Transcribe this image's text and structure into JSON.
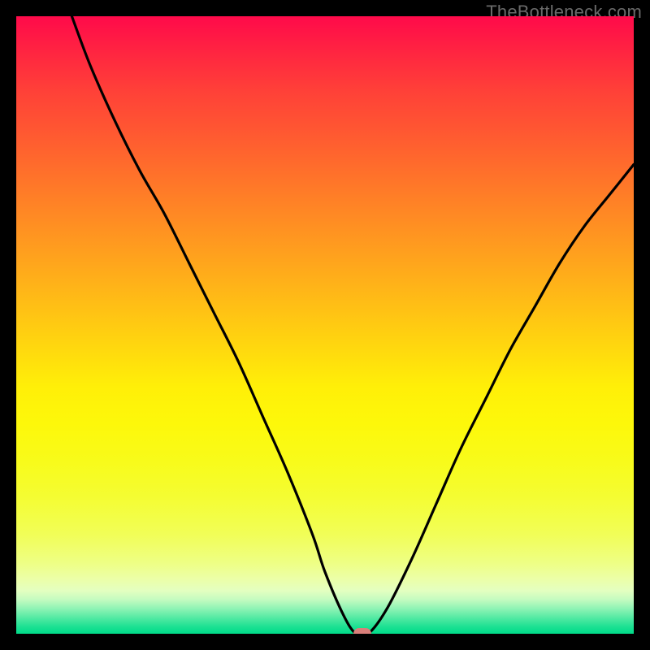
{
  "attribution": "TheBottleneck.com",
  "colors": {
    "background": "#000000",
    "curve": "#000000",
    "marker": "#d97f7a",
    "gradient_top": "#ff0a4a",
    "gradient_mid": "#ffef08",
    "gradient_bottom": "#00db89"
  },
  "chart_data": {
    "type": "line",
    "title": "",
    "xlabel": "",
    "ylabel": "",
    "xlim": [
      0,
      100
    ],
    "ylim": [
      0,
      100
    ],
    "grid": false,
    "legend": false,
    "series": [
      {
        "name": "bottleneck-curve",
        "x": [
          9,
          12,
          16,
          20,
          24,
          28,
          32,
          36,
          40,
          44,
          48,
          50,
          53,
          55,
          57,
          60,
          64,
          68,
          72,
          76,
          80,
          84,
          88,
          92,
          96,
          100
        ],
        "y": [
          100,
          92,
          83,
          75,
          68,
          60,
          52,
          44,
          35,
          26,
          16,
          10,
          3,
          0,
          0,
          4,
          12,
          21,
          30,
          38,
          46,
          53,
          60,
          66,
          71,
          76
        ]
      }
    ],
    "marker": {
      "x": 56,
      "y": 0
    },
    "note": "x and y are in percent of plot area (0–100). y=0 is the bottom (green) edge; y=100 is the top (red) edge. Values are read off the curve's pixel positions; the image has no numeric axis labels."
  }
}
